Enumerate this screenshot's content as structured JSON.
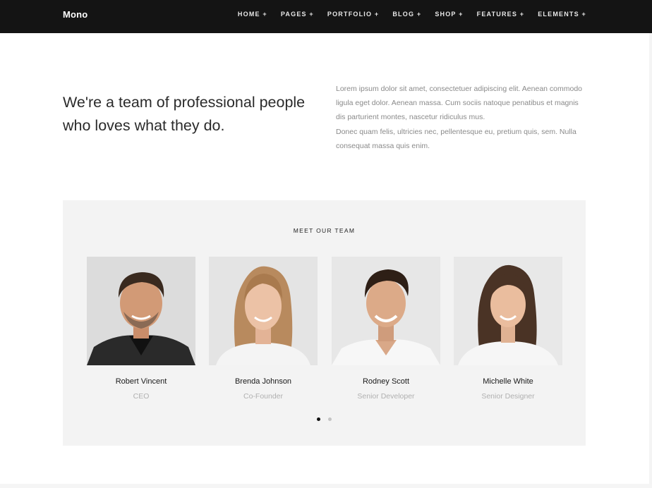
{
  "header": {
    "logo": "Mono",
    "nav": [
      {
        "label": "HOME +"
      },
      {
        "label": "PAGES +"
      },
      {
        "label": "PORTFOLIO +"
      },
      {
        "label": "BLOG +"
      },
      {
        "label": "SHOP +"
      },
      {
        "label": "FEATURES +"
      },
      {
        "label": "ELEMENTS +"
      }
    ]
  },
  "intro": {
    "heading": "We're a team of professional people who loves what they do.",
    "paragraph1": "Lorem ipsum dolor sit amet, consectetuer adipiscing elit. Aenean commodo ligula eget dolor. Aenean massa. Cum sociis natoque penatibus et magnis dis parturient montes, nascetur ridiculus mus.",
    "paragraph2": "Donec quam felis, ultricies nec, pellentesque eu, pretium quis, sem. Nulla consequat massa quis enim."
  },
  "team": {
    "title": "MEET OUR TEAM",
    "members": [
      {
        "name": "Robert Vincent",
        "role": "CEO"
      },
      {
        "name": "Brenda Johnson",
        "role": "Co-Founder"
      },
      {
        "name": "Rodney Scott",
        "role": "Senior Developer"
      },
      {
        "name": "Michelle White",
        "role": "Senior Designer"
      }
    ],
    "carousel": {
      "pages": 2,
      "active_page": 1
    }
  },
  "colors": {
    "navbar_bg": "#141414",
    "team_section_bg": "#f3f3f3",
    "muted_text": "#8a8a8a",
    "active_dot": "#111111"
  }
}
